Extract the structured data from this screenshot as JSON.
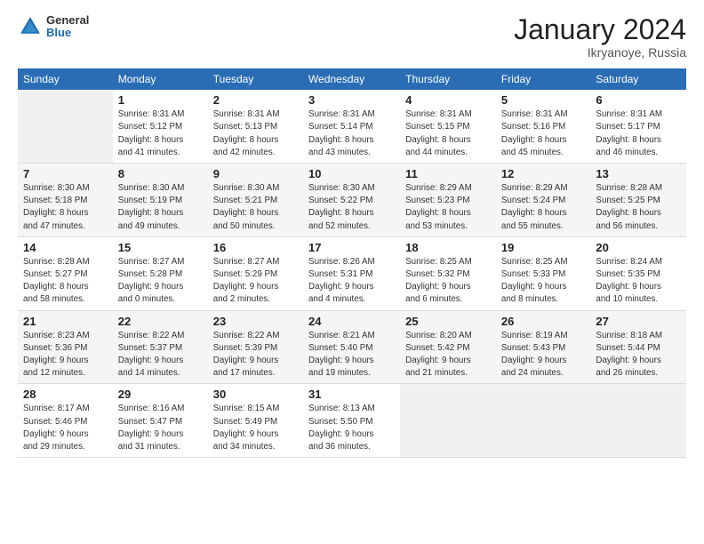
{
  "logo": {
    "general": "General",
    "blue": "Blue"
  },
  "header": {
    "month": "January 2024",
    "location": "Ikryanoye, Russia"
  },
  "weekdays": [
    "Sunday",
    "Monday",
    "Tuesday",
    "Wednesday",
    "Thursday",
    "Friday",
    "Saturday"
  ],
  "weeks": [
    [
      {
        "day": null
      },
      {
        "day": "1",
        "sunrise": "Sunrise: 8:31 AM",
        "sunset": "Sunset: 5:12 PM",
        "daylight": "Daylight: 8 hours and 41 minutes."
      },
      {
        "day": "2",
        "sunrise": "Sunrise: 8:31 AM",
        "sunset": "Sunset: 5:13 PM",
        "daylight": "Daylight: 8 hours and 42 minutes."
      },
      {
        "day": "3",
        "sunrise": "Sunrise: 8:31 AM",
        "sunset": "Sunset: 5:14 PM",
        "daylight": "Daylight: 8 hours and 43 minutes."
      },
      {
        "day": "4",
        "sunrise": "Sunrise: 8:31 AM",
        "sunset": "Sunset: 5:15 PM",
        "daylight": "Daylight: 8 hours and 44 minutes."
      },
      {
        "day": "5",
        "sunrise": "Sunrise: 8:31 AM",
        "sunset": "Sunset: 5:16 PM",
        "daylight": "Daylight: 8 hours and 45 minutes."
      },
      {
        "day": "6",
        "sunrise": "Sunrise: 8:31 AM",
        "sunset": "Sunset: 5:17 PM",
        "daylight": "Daylight: 8 hours and 46 minutes."
      }
    ],
    [
      {
        "day": "7",
        "sunrise": "Sunrise: 8:30 AM",
        "sunset": "Sunset: 5:18 PM",
        "daylight": "Daylight: 8 hours and 47 minutes."
      },
      {
        "day": "8",
        "sunrise": "Sunrise: 8:30 AM",
        "sunset": "Sunset: 5:19 PM",
        "daylight": "Daylight: 8 hours and 49 minutes."
      },
      {
        "day": "9",
        "sunrise": "Sunrise: 8:30 AM",
        "sunset": "Sunset: 5:21 PM",
        "daylight": "Daylight: 8 hours and 50 minutes."
      },
      {
        "day": "10",
        "sunrise": "Sunrise: 8:30 AM",
        "sunset": "Sunset: 5:22 PM",
        "daylight": "Daylight: 8 hours and 52 minutes."
      },
      {
        "day": "11",
        "sunrise": "Sunrise: 8:29 AM",
        "sunset": "Sunset: 5:23 PM",
        "daylight": "Daylight: 8 hours and 53 minutes."
      },
      {
        "day": "12",
        "sunrise": "Sunrise: 8:29 AM",
        "sunset": "Sunset: 5:24 PM",
        "daylight": "Daylight: 8 hours and 55 minutes."
      },
      {
        "day": "13",
        "sunrise": "Sunrise: 8:28 AM",
        "sunset": "Sunset: 5:25 PM",
        "daylight": "Daylight: 8 hours and 56 minutes."
      }
    ],
    [
      {
        "day": "14",
        "sunrise": "Sunrise: 8:28 AM",
        "sunset": "Sunset: 5:27 PM",
        "daylight": "Daylight: 8 hours and 58 minutes."
      },
      {
        "day": "15",
        "sunrise": "Sunrise: 8:27 AM",
        "sunset": "Sunset: 5:28 PM",
        "daylight": "Daylight: 9 hours and 0 minutes."
      },
      {
        "day": "16",
        "sunrise": "Sunrise: 8:27 AM",
        "sunset": "Sunset: 5:29 PM",
        "daylight": "Daylight: 9 hours and 2 minutes."
      },
      {
        "day": "17",
        "sunrise": "Sunrise: 8:26 AM",
        "sunset": "Sunset: 5:31 PM",
        "daylight": "Daylight: 9 hours and 4 minutes."
      },
      {
        "day": "18",
        "sunrise": "Sunrise: 8:25 AM",
        "sunset": "Sunset: 5:32 PM",
        "daylight": "Daylight: 9 hours and 6 minutes."
      },
      {
        "day": "19",
        "sunrise": "Sunrise: 8:25 AM",
        "sunset": "Sunset: 5:33 PM",
        "daylight": "Daylight: 9 hours and 8 minutes."
      },
      {
        "day": "20",
        "sunrise": "Sunrise: 8:24 AM",
        "sunset": "Sunset: 5:35 PM",
        "daylight": "Daylight: 9 hours and 10 minutes."
      }
    ],
    [
      {
        "day": "21",
        "sunrise": "Sunrise: 8:23 AM",
        "sunset": "Sunset: 5:36 PM",
        "daylight": "Daylight: 9 hours and 12 minutes."
      },
      {
        "day": "22",
        "sunrise": "Sunrise: 8:22 AM",
        "sunset": "Sunset: 5:37 PM",
        "daylight": "Daylight: 9 hours and 14 minutes."
      },
      {
        "day": "23",
        "sunrise": "Sunrise: 8:22 AM",
        "sunset": "Sunset: 5:39 PM",
        "daylight": "Daylight: 9 hours and 17 minutes."
      },
      {
        "day": "24",
        "sunrise": "Sunrise: 8:21 AM",
        "sunset": "Sunset: 5:40 PM",
        "daylight": "Daylight: 9 hours and 19 minutes."
      },
      {
        "day": "25",
        "sunrise": "Sunrise: 8:20 AM",
        "sunset": "Sunset: 5:42 PM",
        "daylight": "Daylight: 9 hours and 21 minutes."
      },
      {
        "day": "26",
        "sunrise": "Sunrise: 8:19 AM",
        "sunset": "Sunset: 5:43 PM",
        "daylight": "Daylight: 9 hours and 24 minutes."
      },
      {
        "day": "27",
        "sunrise": "Sunrise: 8:18 AM",
        "sunset": "Sunset: 5:44 PM",
        "daylight": "Daylight: 9 hours and 26 minutes."
      }
    ],
    [
      {
        "day": "28",
        "sunrise": "Sunrise: 8:17 AM",
        "sunset": "Sunset: 5:46 PM",
        "daylight": "Daylight: 9 hours and 29 minutes."
      },
      {
        "day": "29",
        "sunrise": "Sunrise: 8:16 AM",
        "sunset": "Sunset: 5:47 PM",
        "daylight": "Daylight: 9 hours and 31 minutes."
      },
      {
        "day": "30",
        "sunrise": "Sunrise: 8:15 AM",
        "sunset": "Sunset: 5:49 PM",
        "daylight": "Daylight: 9 hours and 34 minutes."
      },
      {
        "day": "31",
        "sunrise": "Sunrise: 8:13 AM",
        "sunset": "Sunset: 5:50 PM",
        "daylight": "Daylight: 9 hours and 36 minutes."
      },
      {
        "day": null
      },
      {
        "day": null
      },
      {
        "day": null
      }
    ]
  ]
}
